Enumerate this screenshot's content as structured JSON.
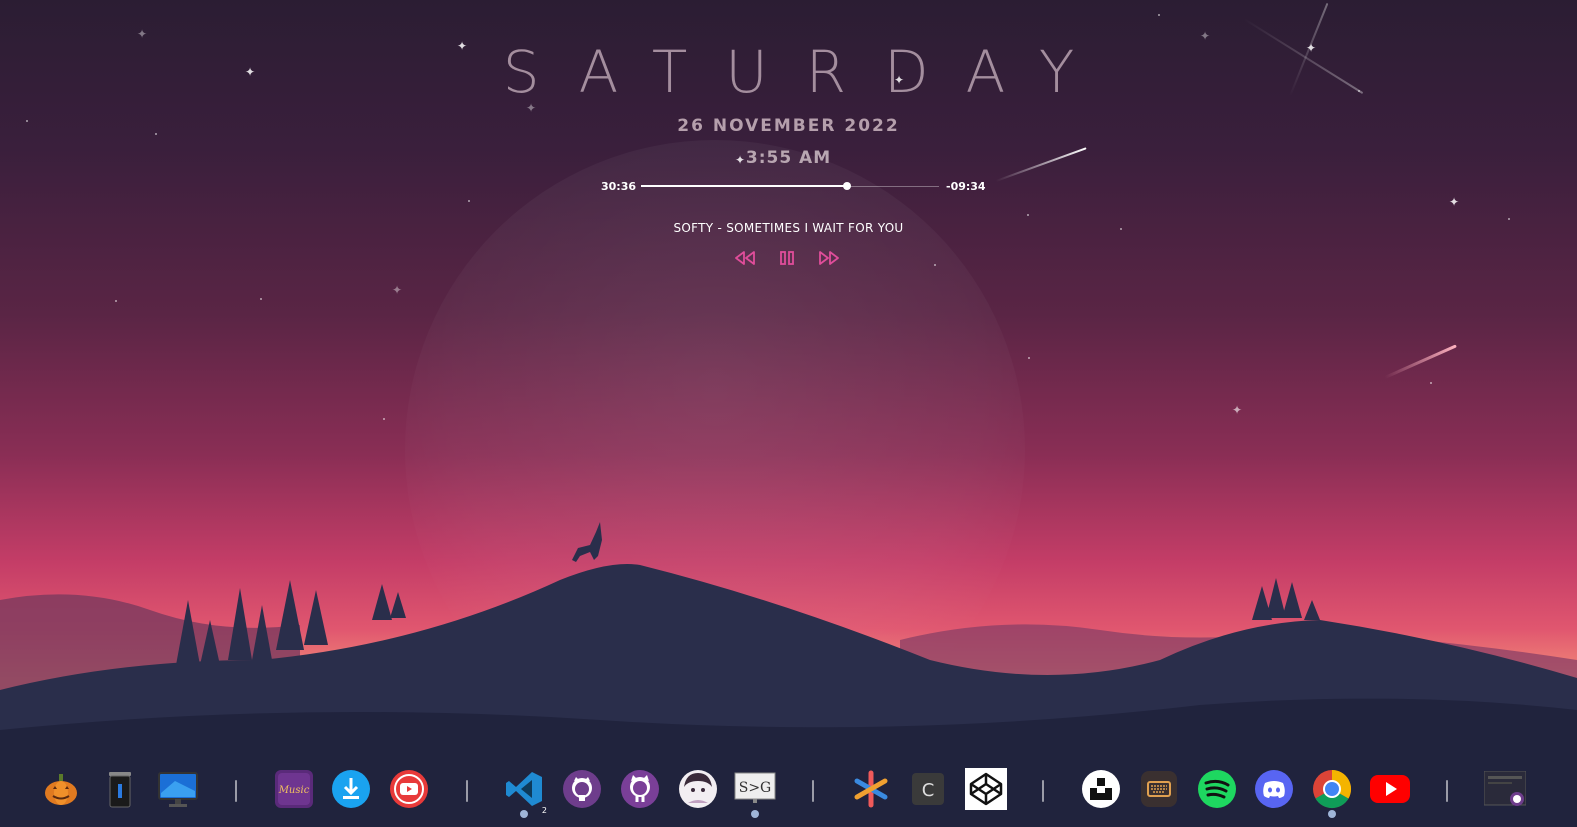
{
  "widget": {
    "day": "SATURDAY",
    "date": "26 NOVEMBER 2022",
    "time": "3:55 AM",
    "elapsed": "30:36",
    "remaining": "-09:34",
    "progress_fraction": 0.69,
    "song": "SOFTY - SOMETIMES I WAIT FOR YOU",
    "accent_color": "#e04d9a",
    "controls": [
      "rewind-icon",
      "pause-icon",
      "fast-forward-icon"
    ]
  },
  "dock": {
    "groups": [
      [
        "pumpkin-icon",
        "trash-bin-icon",
        "monitor-icon"
      ],
      [
        "music-app-icon",
        "download-icon",
        "youtube-downloader-icon"
      ],
      [
        "vscode-icon",
        "github-icon",
        "github-desktop-icon",
        "anime-avatar-icon",
        "sg-terminal-icon"
      ],
      [
        "asterisk-app-icon",
        "c-app-icon",
        "codepen-icon"
      ],
      [
        "unsplash-icon",
        "keyboard-icon",
        "spotify-icon",
        "discord-icon",
        "chrome-icon",
        "youtube-icon"
      ],
      [
        "window-preview-icon"
      ]
    ],
    "music_app_label": "Music",
    "vscode_badge": "2",
    "c_app_label": "C",
    "sg_label": "S>G"
  }
}
